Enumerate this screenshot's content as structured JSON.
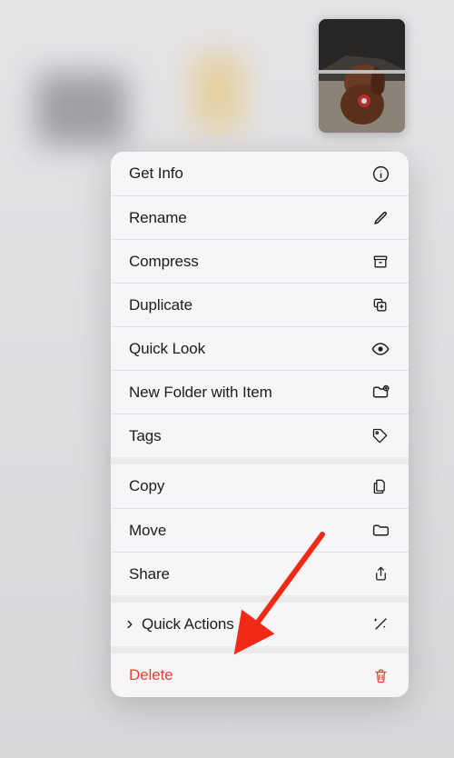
{
  "thumbnail": {
    "alt": "dog-in-car"
  },
  "menu": {
    "groups": [
      {
        "items": [
          {
            "key": "get-info",
            "label": "Get Info",
            "icon": "info-circle-icon"
          },
          {
            "key": "rename",
            "label": "Rename",
            "icon": "pencil-icon"
          },
          {
            "key": "compress",
            "label": "Compress",
            "icon": "archivebox-icon"
          },
          {
            "key": "duplicate",
            "label": "Duplicate",
            "icon": "duplicate-icon"
          },
          {
            "key": "quicklook",
            "label": "Quick Look",
            "icon": "eye-icon"
          },
          {
            "key": "newfolder",
            "label": "New Folder with Item",
            "icon": "folder-plus-icon"
          },
          {
            "key": "tags",
            "label": "Tags",
            "icon": "tag-icon"
          }
        ]
      },
      {
        "items": [
          {
            "key": "copy",
            "label": "Copy",
            "icon": "doc-on-doc-icon"
          },
          {
            "key": "move",
            "label": "Move",
            "icon": "folder-icon"
          },
          {
            "key": "share",
            "label": "Share",
            "icon": "share-icon"
          }
        ]
      },
      {
        "items": [
          {
            "key": "quickactions",
            "label": "Quick Actions",
            "icon": "sparkles-wand-icon",
            "disclosure": true
          }
        ]
      },
      {
        "items": [
          {
            "key": "delete",
            "label": "Delete",
            "icon": "trash-icon",
            "destructive": true
          }
        ]
      }
    ]
  },
  "annotation": {
    "points_to": "quickactions"
  }
}
